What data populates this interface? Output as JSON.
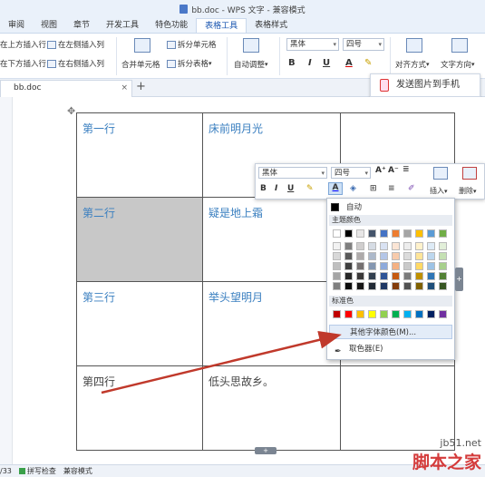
{
  "window": {
    "title": "bb.doc - WPS 文字 - 兼容模式"
  },
  "ribbon_tabs": [
    "审阅",
    "视图",
    "章节",
    "开发工具",
    "特色功能",
    "表格工具",
    "表格样式"
  ],
  "ribbon": {
    "insert_above": "在上方插入行",
    "insert_left": "在左侧插入列",
    "insert_below": "在下方插入行",
    "insert_right": "在右侧插入列",
    "merge_cells": "合并单元格",
    "split_cells": "拆分单元格",
    "split_table": "拆分表格",
    "auto_adjust": "自动调整",
    "font_name": "黑体",
    "font_size": "四号",
    "align": "对齐方式",
    "text_dir": "文字方向"
  },
  "doc_tab": {
    "name": "bb.doc",
    "close": "×",
    "new": "+"
  },
  "send_button": "发送图片到手机",
  "table": {
    "rows": [
      [
        "第一行",
        "床前明月光",
        ""
      ],
      [
        "第二行",
        "疑是地上霜",
        ""
      ],
      [
        "第三行",
        "举头望明月",
        ""
      ],
      [
        "第四行",
        "低头思故乡。",
        ""
      ]
    ]
  },
  "mini_toolbar": {
    "font_name": "黑体",
    "font_size": "四号",
    "insert_label": "插入",
    "delete_label": "删除"
  },
  "color_dropdown": {
    "auto_label": "自动",
    "theme_header": "主题颜色",
    "standard_header": "标准色",
    "more_colors": "其他字体颜色(M)...",
    "eyedropper": "取色器(E)",
    "theme_top": [
      "#ffffff",
      "#000000",
      "#e7e6e6",
      "#44546a",
      "#4472c4",
      "#ed7d31",
      "#a5a5a5",
      "#ffc000",
      "#5b9bd5",
      "#70ad47"
    ],
    "theme_shades": [
      [
        "#f2f2f2",
        "#7f7f7f",
        "#d0cece",
        "#d6dce4",
        "#d9e2f3",
        "#fbe5d5",
        "#ededed",
        "#fff2cc",
        "#deebf6",
        "#e2efd9"
      ],
      [
        "#d8d8d8",
        "#595959",
        "#aeaaaa",
        "#adb9ca",
        "#b4c6e7",
        "#f7cbac",
        "#dbdbdb",
        "#fee599",
        "#bdd7ee",
        "#c5e0b3"
      ],
      [
        "#bfbfbf",
        "#3f3f3f",
        "#757070",
        "#8496b0",
        "#8eaadb",
        "#f4b183",
        "#c9c9c9",
        "#ffd965",
        "#9dc3e6",
        "#a8d08d"
      ],
      [
        "#a5a5a5",
        "#262626",
        "#3a3838",
        "#323f4f",
        "#2f5496",
        "#c55a11",
        "#7b7b7b",
        "#bf9000",
        "#2e75b5",
        "#538135"
      ],
      [
        "#7f7f7f",
        "#0c0c0c",
        "#171616",
        "#222a35",
        "#1f3864",
        "#833c0b",
        "#525252",
        "#7f6000",
        "#1e4e79",
        "#375623"
      ]
    ],
    "standard": [
      "#c00000",
      "#ff0000",
      "#ffc000",
      "#ffff00",
      "#92d050",
      "#00b050",
      "#00b0f0",
      "#0070c0",
      "#002060",
      "#7030a0"
    ]
  },
  "status_bar": {
    "page": "/33",
    "spell": "拼写检查",
    "compat": "兼容模式"
  },
  "watermark": {
    "line1": "jb51.net",
    "line2": "脚本之家"
  }
}
